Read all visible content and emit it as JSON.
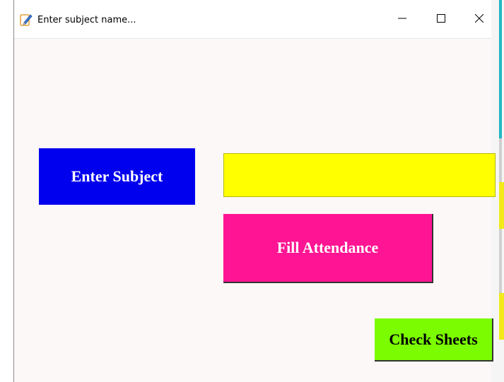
{
  "window": {
    "title": "Enter subject name..."
  },
  "buttons": {
    "enter_subject": "Enter Subject",
    "fill_attendance": "Fill Attendance",
    "check_sheets": "Check Sheets"
  },
  "subject_input": {
    "value": "",
    "placeholder": ""
  },
  "colors": {
    "enter_subject_bg": "#0000ee",
    "subject_input_bg": "#ffff00",
    "fill_attendance_bg": "#ff1493",
    "check_sheets_bg": "#7cfc00",
    "window_bg": "#fcf8f7"
  },
  "icons": {
    "app": "edit-note-icon",
    "minimize": "minimize-icon",
    "maximize": "maximize-icon",
    "close": "close-icon"
  }
}
